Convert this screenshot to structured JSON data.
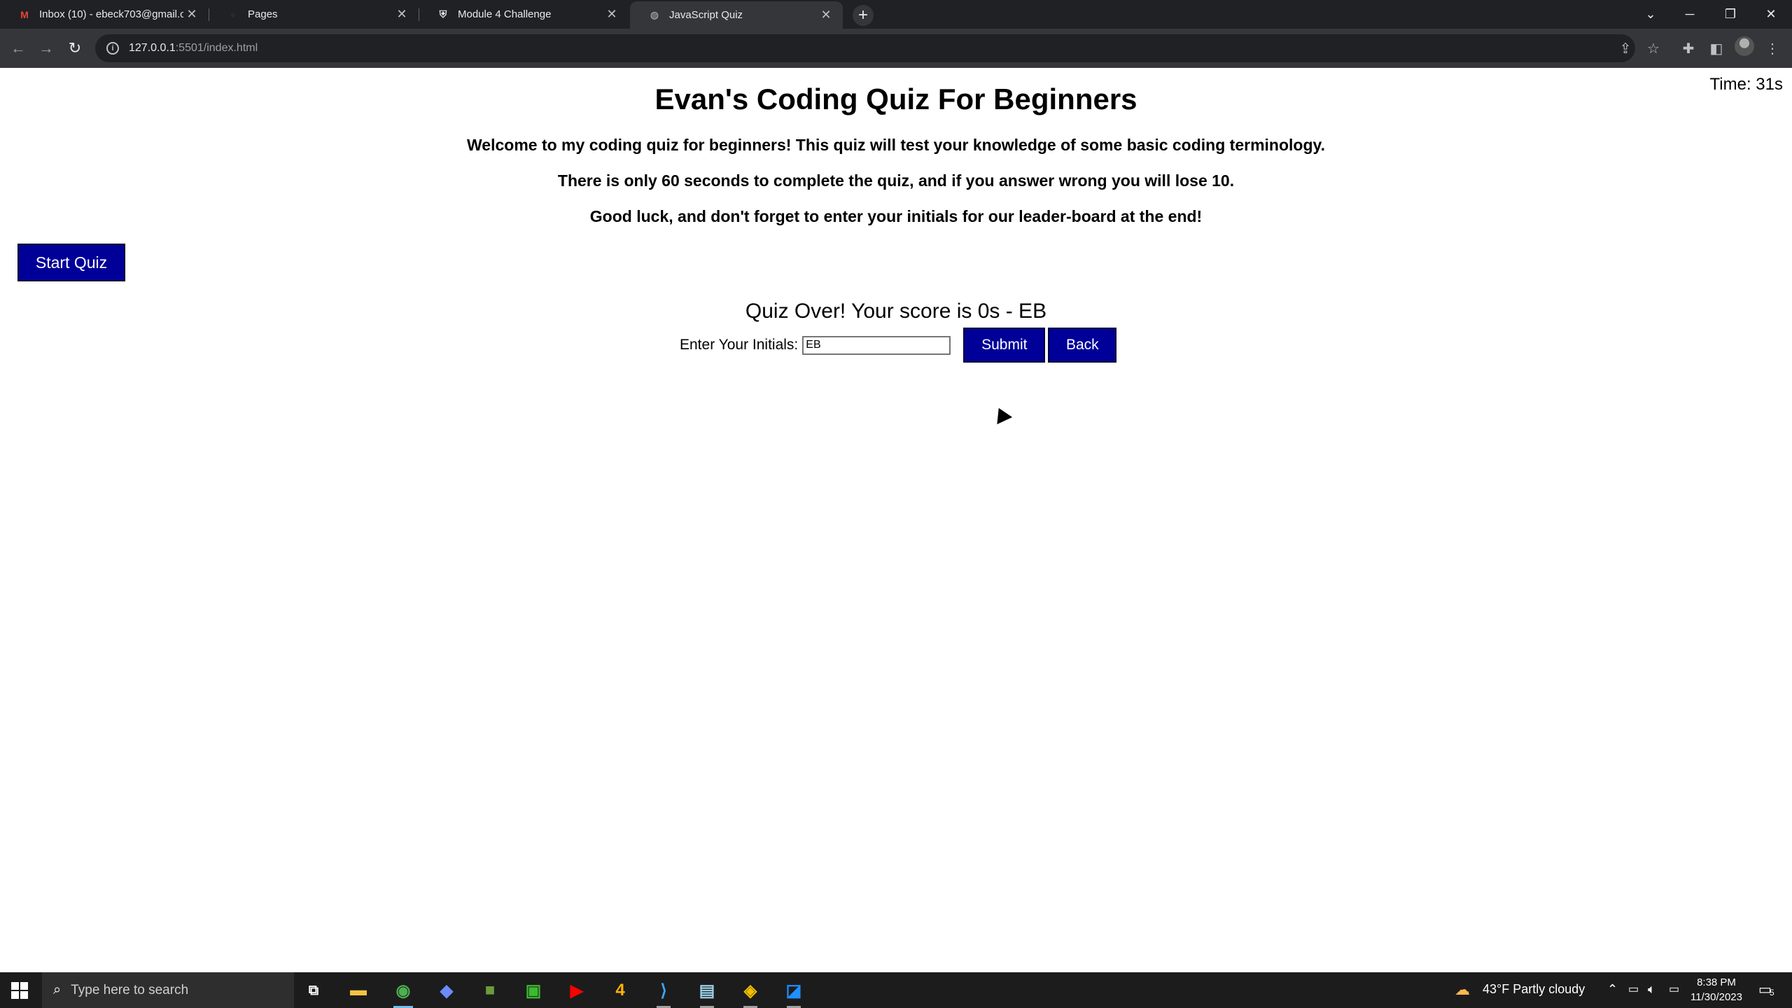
{
  "browser": {
    "tabs": [
      {
        "title": "Inbox (10) - ebeck703@gmail.co",
        "icon": "gmail-icon"
      },
      {
        "title": "Pages",
        "icon": "github-icon"
      },
      {
        "title": "Module 4 Challenge",
        "icon": "university-icon"
      },
      {
        "title": "JavaScript Quiz",
        "icon": "globe-icon",
        "active": true
      }
    ],
    "url_host": "127.0.0.1",
    "url_path": ":5501/index.html"
  },
  "page": {
    "timer": "Time: 31s",
    "title": "Evan's Coding Quiz For Beginners",
    "intro": [
      "Welcome to my coding quiz for beginners! This quiz will test your knowledge of some basic coding terminology.",
      "There is only 60 seconds to complete the quiz, and if you answer wrong you will lose 10.",
      "Good luck, and don't forget to enter your initials for our leader-board at the end!"
    ],
    "start_button": "Start Quiz",
    "score_text": "Quiz Over! Your score is 0s - EB",
    "initials_label": "Enter Your Initials:",
    "initials_value": "EB",
    "submit_button": "Submit",
    "back_button": "Back"
  },
  "taskbar": {
    "search_placeholder": "Type here to search",
    "weather": "43°F  Partly cloudy",
    "time": "8:38 PM",
    "date": "11/30/2023",
    "notification_count": "5",
    "colors": {
      "accent": "#76b9ed",
      "background": "#1c1c1c"
    }
  },
  "colors": {
    "button_bg": "#000099",
    "button_text": "#ffffff"
  }
}
